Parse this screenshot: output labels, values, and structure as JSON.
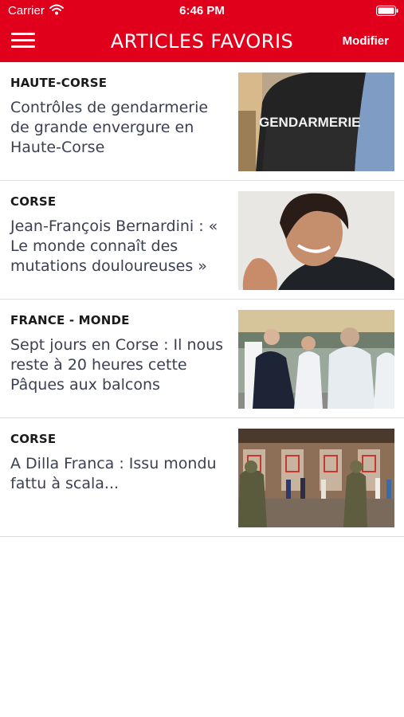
{
  "status_bar": {
    "carrier": "Carrier",
    "time": "6:46 PM",
    "wifi_icon": "wifi-icon",
    "battery_icon": "battery-icon"
  },
  "header": {
    "title": "ARTICLES FAVORIS",
    "edit_label": "Modifier",
    "menu_icon": "hamburger-menu-icon",
    "background_color": "#e1001b",
    "text_color": "#ffffff"
  },
  "articles": [
    {
      "category": "HAUTE-CORSE",
      "title": "Contrôles de gendarmerie de grande envergure en Haute-Corse",
      "image_text": "GENDARMERIE"
    },
    {
      "category": "CORSE",
      "title": "Jean-François Bernardini : « Le monde connaît des mutations douloureuses »"
    },
    {
      "category": "FRANCE - MONDE",
      "title": "Sept jours en Corse : Il nous reste à 20 heures cette Pâques aux balcons"
    },
    {
      "category": "CORSE",
      "title": "A Dilla Franca : Issu mondu fattu à scala..."
    }
  ]
}
